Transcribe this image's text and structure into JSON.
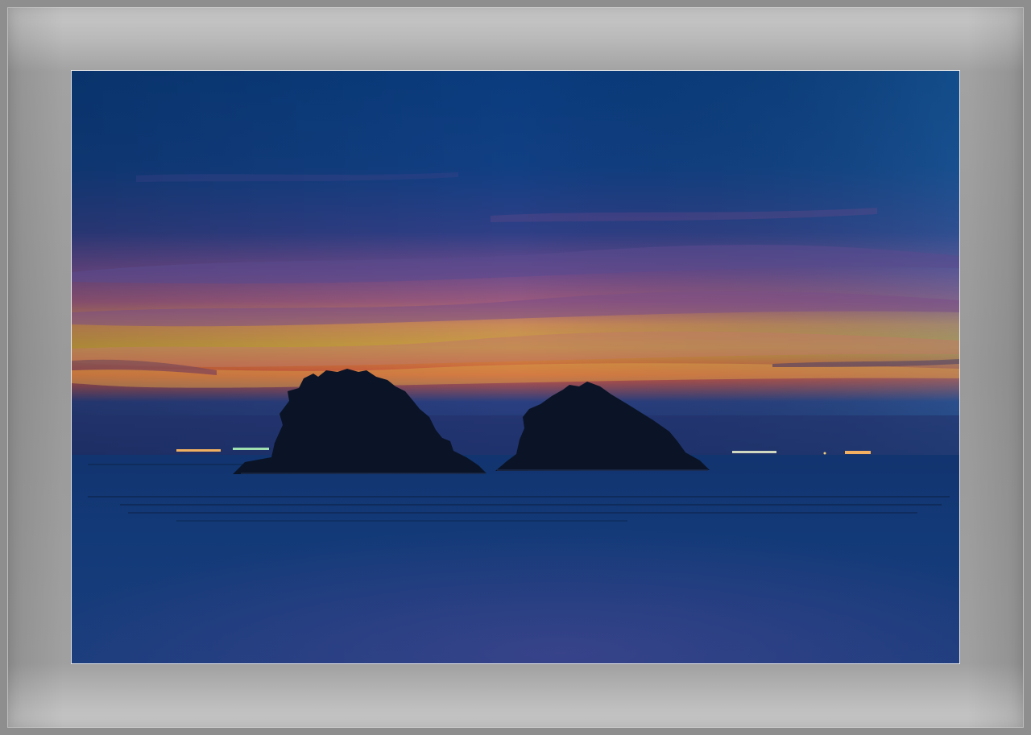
{
  "image": {
    "subject": "twin-islets-at-dusk",
    "colors": {
      "sky_top": "#0b3f7f",
      "sky_mid": "#3a3f86",
      "sky_pink": "#8a4a86",
      "horizon_orange": "#d9903a",
      "horizon_red": "#d24a4a",
      "sea": "#123a78",
      "sea_deep": "#0e2c63",
      "silhouette": "#0a1426",
      "frame": "#9e9e9e"
    }
  }
}
